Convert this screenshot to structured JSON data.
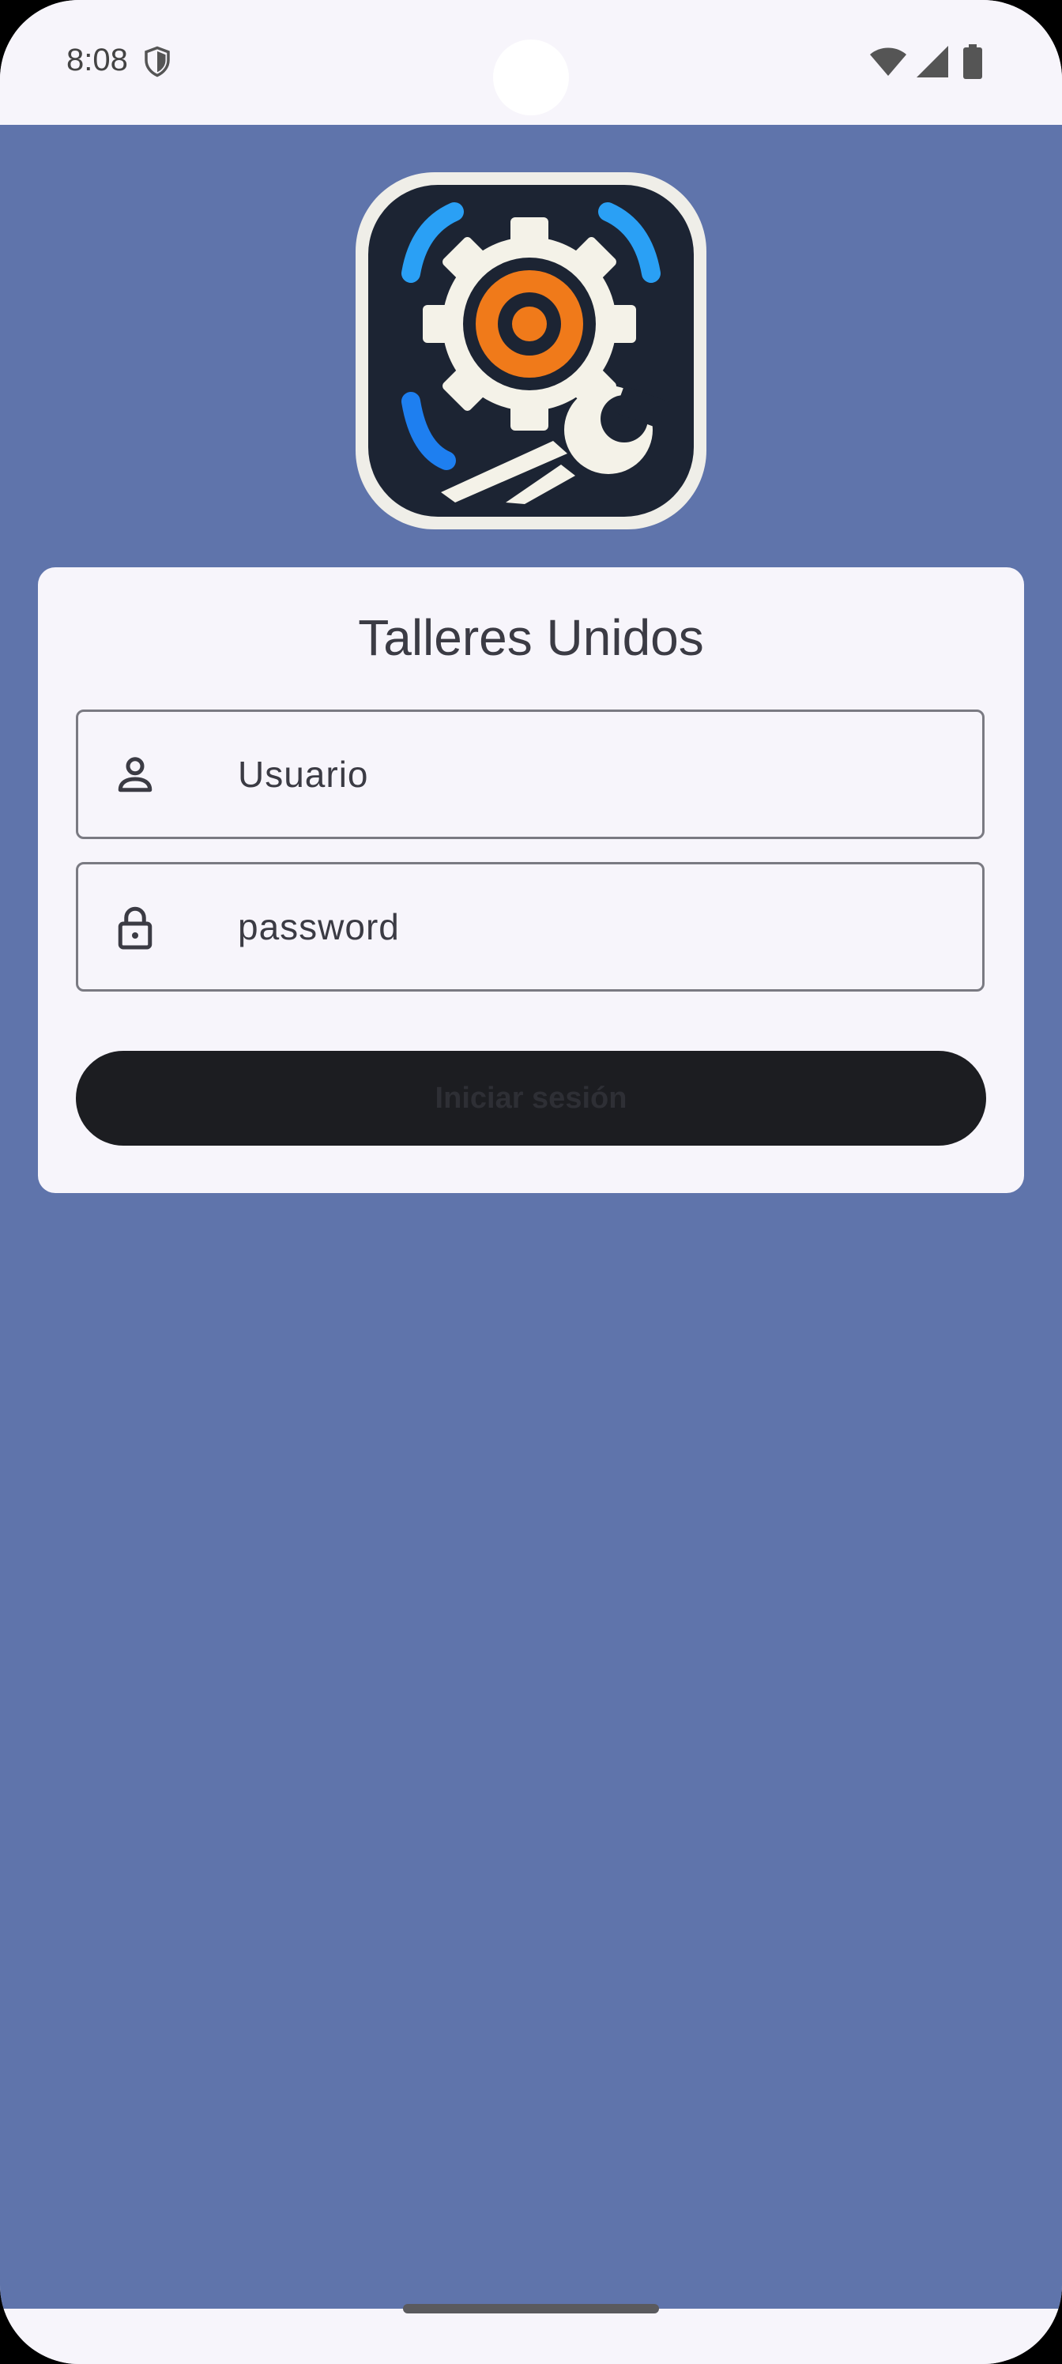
{
  "status_bar": {
    "time": "8:08",
    "icons": [
      "shield-icon",
      "wifi-icon",
      "cellular-signal-icon",
      "battery-icon"
    ]
  },
  "app": {
    "logo": "gear-wrench-logo",
    "title": "Talleres Unidos"
  },
  "login": {
    "username_placeholder": "Usuario",
    "password_placeholder": "password",
    "submit_label": "Iniciar sesión"
  },
  "colors": {
    "background": "#5f74ab",
    "card": "#f7f5fb",
    "button": "#1c1d21",
    "logo_orange": "#f07a1a",
    "logo_blue": "#1e90ff"
  }
}
